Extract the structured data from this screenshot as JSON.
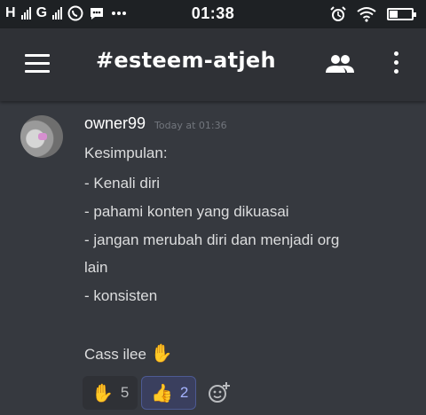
{
  "status_bar": {
    "carrier1": "H",
    "carrier2": "G",
    "time": "01:38",
    "battery_level": 0.35
  },
  "header": {
    "channel_name": "#esteem-atjeh"
  },
  "message": {
    "author": "owner99",
    "timestamp": "Today at 01:36",
    "lines": [
      "Kesimpulan:",
      "- Kenali diri",
      "- pahami konten yang dikuasai",
      "- jangan merubah diri dan menjadi org",
      "lain",
      "- konsisten",
      "",
      "Cass ilee"
    ],
    "trailing_emoji": "✋"
  },
  "reactions": [
    {
      "emoji": "✋",
      "count": "5"
    },
    {
      "emoji": "👍",
      "count": "2"
    }
  ],
  "icons": {
    "menu": "hamburger-menu-icon",
    "members": "members-icon",
    "more": "more-vertical-icon",
    "add_reaction": "add-reaction-icon"
  },
  "colors": {
    "background": "#36393f",
    "header": "#2f3136",
    "status_bar": "#1e2124",
    "reaction_active_bg": "#3a3f5e",
    "reaction_active_text": "#a6b4ff"
  }
}
